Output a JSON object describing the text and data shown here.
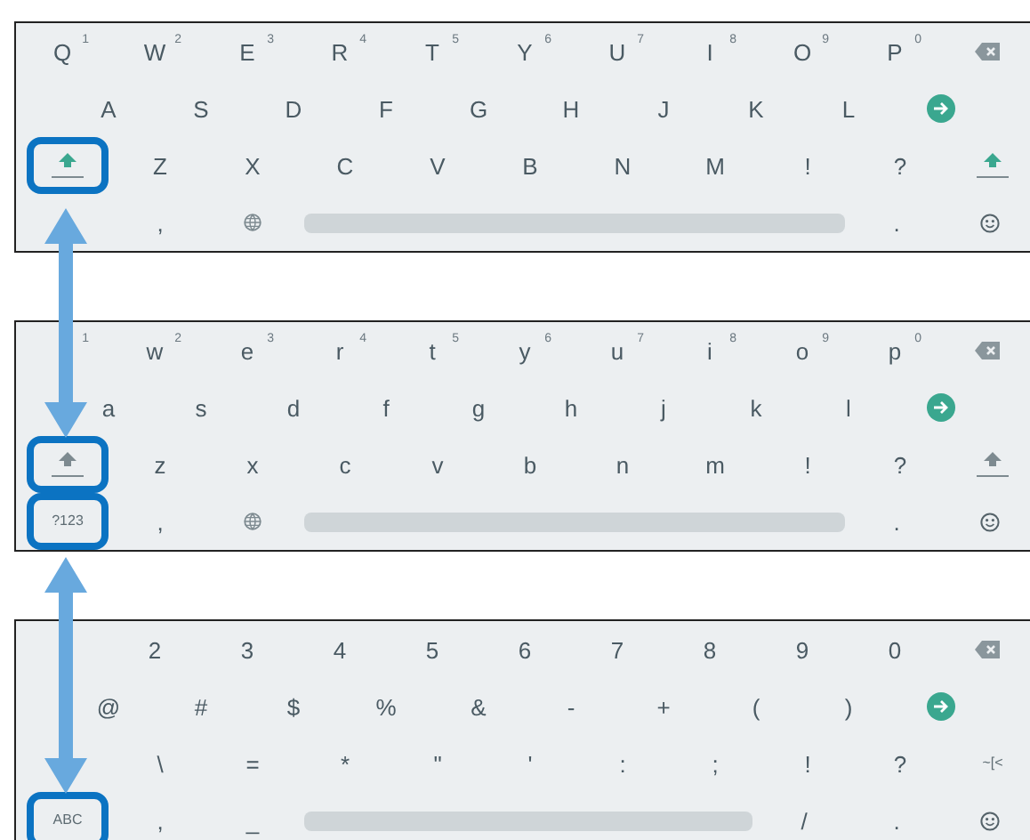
{
  "panels": [
    {
      "rows": [
        {
          "keys": [
            {
              "kind": "char",
              "label": "Q",
              "sup": "1"
            },
            {
              "kind": "char",
              "label": "W",
              "sup": "2"
            },
            {
              "kind": "char",
              "label": "E",
              "sup": "3"
            },
            {
              "kind": "char",
              "label": "R",
              "sup": "4"
            },
            {
              "kind": "char",
              "label": "T",
              "sup": "5"
            },
            {
              "kind": "char",
              "label": "Y",
              "sup": "6"
            },
            {
              "kind": "char",
              "label": "U",
              "sup": "7"
            },
            {
              "kind": "char",
              "label": "I",
              "sup": "8"
            },
            {
              "kind": "char",
              "label": "O",
              "sup": "9"
            },
            {
              "kind": "char",
              "label": "P",
              "sup": "0"
            },
            {
              "kind": "backspace"
            }
          ]
        },
        {
          "keys": [
            {
              "kind": "char",
              "label": "A"
            },
            {
              "kind": "char",
              "label": "S"
            },
            {
              "kind": "char",
              "label": "D"
            },
            {
              "kind": "char",
              "label": "F"
            },
            {
              "kind": "char",
              "label": "G"
            },
            {
              "kind": "char",
              "label": "H"
            },
            {
              "kind": "char",
              "label": "J"
            },
            {
              "kind": "char",
              "label": "K"
            },
            {
              "kind": "char",
              "label": "L"
            },
            {
              "kind": "enter"
            }
          ]
        },
        {
          "keys": [
            {
              "kind": "shift",
              "on": true,
              "highlighted": true
            },
            {
              "kind": "char",
              "label": "Z"
            },
            {
              "kind": "char",
              "label": "X"
            },
            {
              "kind": "char",
              "label": "C"
            },
            {
              "kind": "char",
              "label": "V"
            },
            {
              "kind": "char",
              "label": "B"
            },
            {
              "kind": "char",
              "label": "N"
            },
            {
              "kind": "char",
              "label": "M"
            },
            {
              "kind": "char",
              "label": "!"
            },
            {
              "kind": "char",
              "label": "?"
            },
            {
              "kind": "shift",
              "on": true,
              "highlighted": false
            }
          ]
        },
        {
          "keys": [
            {
              "kind": "mode"
            },
            {
              "kind": "char",
              "label": ","
            },
            {
              "kind": "globe"
            },
            {
              "kind": "space"
            },
            {
              "kind": "char",
              "label": "."
            },
            {
              "kind": "emoji"
            }
          ]
        }
      ]
    },
    {
      "rows": [
        {
          "keys": [
            {
              "kind": "char",
              "sup": "1"
            },
            {
              "kind": "char",
              "label": "w",
              "sup": "2"
            },
            {
              "kind": "char",
              "label": "e",
              "sup": "3"
            },
            {
              "kind": "char",
              "label": "r",
              "sup": "4"
            },
            {
              "kind": "char",
              "label": "t",
              "sup": "5"
            },
            {
              "kind": "char",
              "label": "y",
              "sup": "6"
            },
            {
              "kind": "char",
              "label": "u",
              "sup": "7"
            },
            {
              "kind": "char",
              "label": "i",
              "sup": "8"
            },
            {
              "kind": "char",
              "label": "o",
              "sup": "9"
            },
            {
              "kind": "char",
              "label": "p",
              "sup": "0"
            },
            {
              "kind": "backspace"
            }
          ]
        },
        {
          "keys": [
            {
              "kind": "char",
              "label": "a"
            },
            {
              "kind": "char",
              "label": "s"
            },
            {
              "kind": "char",
              "label": "d"
            },
            {
              "kind": "char",
              "label": "f"
            },
            {
              "kind": "char",
              "label": "g"
            },
            {
              "kind": "char",
              "label": "h"
            },
            {
              "kind": "char",
              "label": "j"
            },
            {
              "kind": "char",
              "label": "k"
            },
            {
              "kind": "char",
              "label": "l"
            },
            {
              "kind": "enter"
            }
          ]
        },
        {
          "keys": [
            {
              "kind": "shift",
              "on": false,
              "highlighted": true
            },
            {
              "kind": "char",
              "label": "z"
            },
            {
              "kind": "char",
              "label": "x"
            },
            {
              "kind": "char",
              "label": "c"
            },
            {
              "kind": "char",
              "label": "v"
            },
            {
              "kind": "char",
              "label": "b"
            },
            {
              "kind": "char",
              "label": "n"
            },
            {
              "kind": "char",
              "label": "m"
            },
            {
              "kind": "char",
              "label": "!"
            },
            {
              "kind": "char",
              "label": "?"
            },
            {
              "kind": "shift",
              "on": false,
              "highlighted": false
            }
          ]
        },
        {
          "keys": [
            {
              "kind": "mode",
              "label": "?123",
              "highlighted": true
            },
            {
              "kind": "char",
              "label": ","
            },
            {
              "kind": "globe"
            },
            {
              "kind": "space"
            },
            {
              "kind": "char",
              "label": "."
            },
            {
              "kind": "emoji"
            }
          ]
        }
      ]
    },
    {
      "rows": [
        {
          "keys": [
            {
              "kind": "char"
            },
            {
              "kind": "char",
              "label": "2"
            },
            {
              "kind": "char",
              "label": "3"
            },
            {
              "kind": "char",
              "label": "4"
            },
            {
              "kind": "char",
              "label": "5"
            },
            {
              "kind": "char",
              "label": "6"
            },
            {
              "kind": "char",
              "label": "7"
            },
            {
              "kind": "char",
              "label": "8"
            },
            {
              "kind": "char",
              "label": "9"
            },
            {
              "kind": "char",
              "label": "0"
            },
            {
              "kind": "backspace"
            }
          ]
        },
        {
          "keys": [
            {
              "kind": "char",
              "label": "@"
            },
            {
              "kind": "char",
              "label": "#"
            },
            {
              "kind": "char",
              "label": "$"
            },
            {
              "kind": "char",
              "label": "%"
            },
            {
              "kind": "char",
              "label": "&"
            },
            {
              "kind": "char",
              "label": "-"
            },
            {
              "kind": "char",
              "label": "+"
            },
            {
              "kind": "char",
              "label": "("
            },
            {
              "kind": "char",
              "label": ")"
            },
            {
              "kind": "enter"
            }
          ]
        },
        {
          "keys": [
            {
              "kind": "char"
            },
            {
              "kind": "char",
              "label": "\\"
            },
            {
              "kind": "char",
              "label": "="
            },
            {
              "kind": "char",
              "label": "*"
            },
            {
              "kind": "char",
              "label": "\""
            },
            {
              "kind": "char",
              "label": "'"
            },
            {
              "kind": "char",
              "label": ":"
            },
            {
              "kind": "char",
              "label": ";"
            },
            {
              "kind": "char",
              "label": "!"
            },
            {
              "kind": "char",
              "label": "?"
            },
            {
              "kind": "mode",
              "label": "~[<",
              "highlighted": false
            }
          ]
        },
        {
          "keys": [
            {
              "kind": "mode",
              "label": "ABC",
              "highlighted": true
            },
            {
              "kind": "char",
              "label": ","
            },
            {
              "kind": "char",
              "label": "_"
            },
            {
              "kind": "space"
            },
            {
              "kind": "char",
              "label": "/"
            },
            {
              "kind": "char",
              "label": "."
            },
            {
              "kind": "emoji"
            }
          ]
        }
      ]
    }
  ]
}
